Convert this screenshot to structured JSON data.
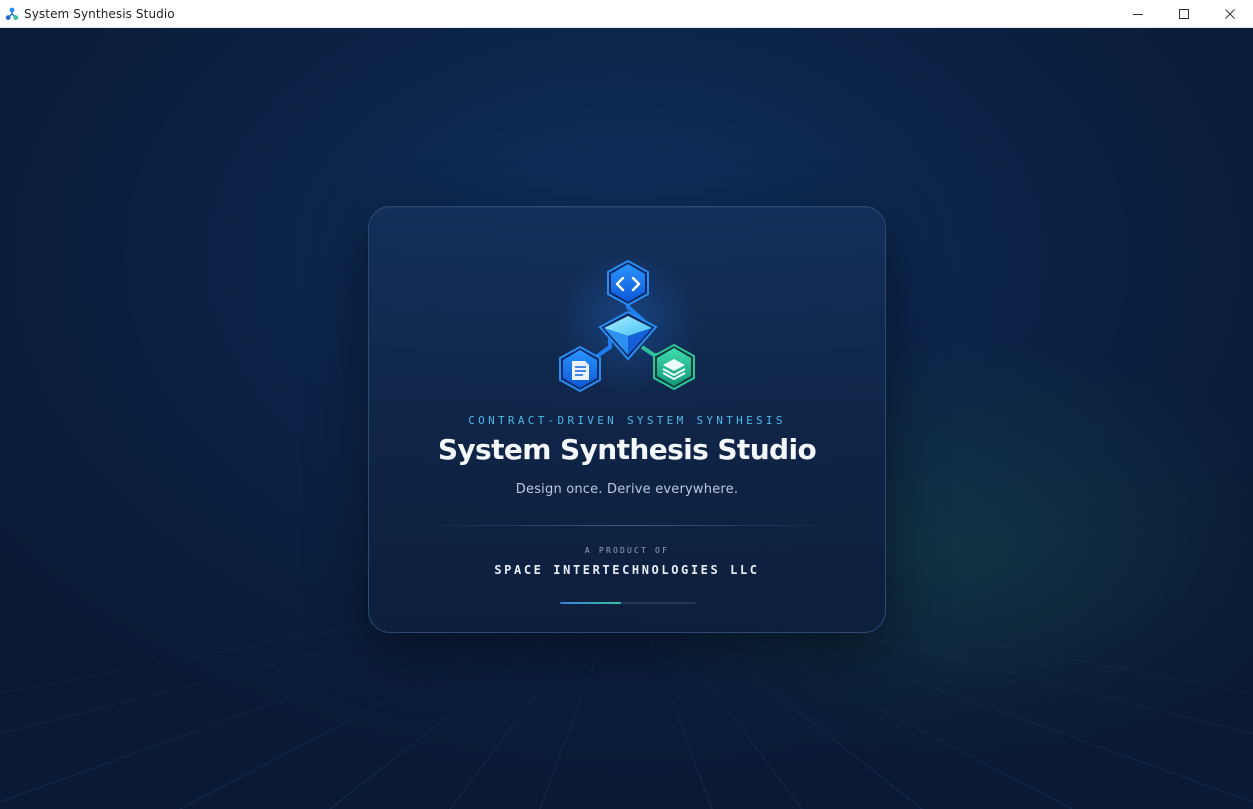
{
  "window": {
    "title": "System Synthesis Studio",
    "app_icon": "molecule-icon",
    "controls": [
      "minimize-icon",
      "maximize-icon",
      "close-icon"
    ]
  },
  "splash": {
    "logo": {
      "icons": [
        "code-brackets-icon",
        "crystal-diamond-icon",
        "document-icon",
        "layers-stack-icon"
      ]
    },
    "tagline": "CONTRACT-DRIVEN SYSTEM SYNTHESIS",
    "app_name": "System Synthesis Studio",
    "subtitle": "Design once. Derive everywhere.",
    "product_of_label": "A PRODUCT OF",
    "company": "SPACE INTERTECHNOLOGIES LLC",
    "loading_progress": 0.45
  },
  "colors": {
    "background": "#0c2449",
    "card_border": "#2a4a73",
    "accent_blue": "#1e8bff",
    "accent_cyan": "#4fb8e8",
    "accent_green": "#2fc39a",
    "text_primary": "#f4f7fb"
  }
}
